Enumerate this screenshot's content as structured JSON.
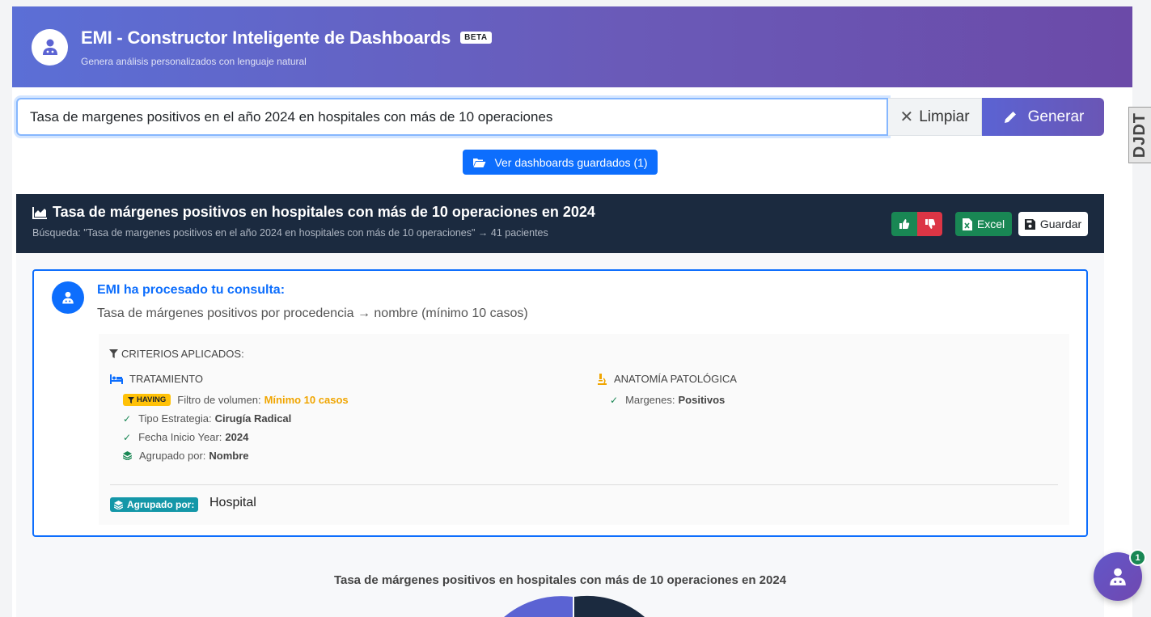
{
  "header": {
    "title": "EMI - Constructor Inteligente de Dashboards",
    "badge": "BETA",
    "subtitle": "Genera análisis personalizados con lenguaje natural"
  },
  "search": {
    "value": "Tasa de margenes positivos en el año 2024 en hospitales con más de 10 operaciones",
    "clear_label": "Limpiar",
    "generate_label": "Generar"
  },
  "saved_button": "Ver dashboards guardados (1)",
  "result": {
    "title": "Tasa de márgenes positivos en hospitales con más de 10 operaciones en 2024",
    "subtitle": "Búsqueda: \"Tasa de margenes positivos en el año 2024 en hospitales con más de 10 operaciones\" → 41 pacientes",
    "excel_label": "Excel",
    "save_label": "Guardar"
  },
  "emi": {
    "heading": "EMI ha procesado tu consulta:",
    "description": "Tasa de márgenes positivos por procedencia → nombre (mínimo 10 casos)",
    "criteria_title": "CRITERIOS APLICADOS:",
    "treatment": {
      "label": "TRATAMIENTO",
      "having_badge": "HAVING",
      "volume_label": "Filtro de volumen:",
      "volume_value": "Mínimo 10 casos",
      "items": [
        {
          "label": "Tipo Estrategia:",
          "value": "Cirugía Radical"
        },
        {
          "label": "Fecha Inicio Year:",
          "value": "2024"
        }
      ],
      "grouped_label": "Agrupado por:",
      "grouped_value": "Nombre"
    },
    "pathology": {
      "label": "ANATOMÍA PATOLÓGICA",
      "items": [
        {
          "label": "Margenes:",
          "value": "Positivos"
        }
      ]
    },
    "group_badge": "Agrupado por:",
    "group_value": "Hospital"
  },
  "chart": {
    "title": "Tasa de márgenes positivos en hospitales con más de 10 operaciones en 2024"
  },
  "fab": {
    "badge": "1"
  },
  "side_tab": {
    "label": "DJDT"
  },
  "colors": {
    "header_gradient_start": "#5b6fd6",
    "header_gradient_end": "#6b4aa8",
    "primary": "#0d6efd",
    "dark_header": "#1b2a3f",
    "success": "#198754",
    "danger": "#dc3545",
    "warning": "#ffc107",
    "info": "#1497a8"
  }
}
